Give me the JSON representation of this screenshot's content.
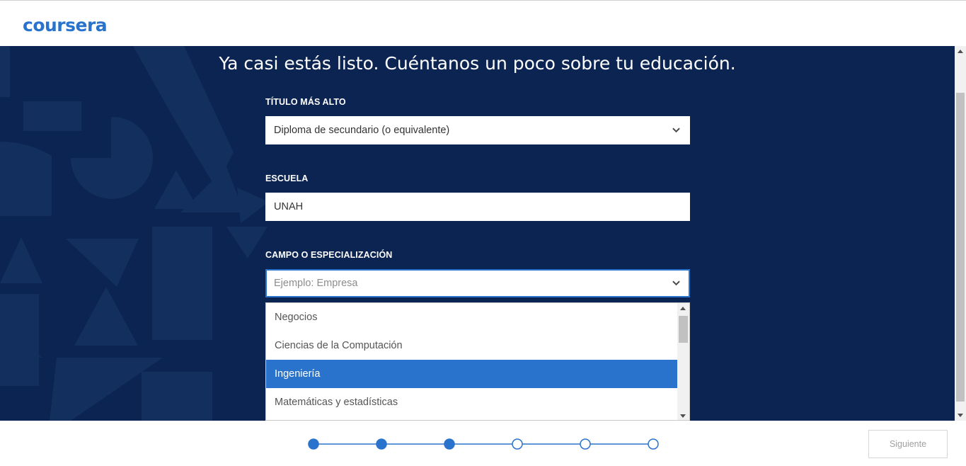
{
  "brand": {
    "logo_text": "coursera",
    "accent": "#2a73cc",
    "hero_bg": "#0b2451"
  },
  "headline": "Ya casi estás listo. Cuéntanos un poco sobre tu educación.",
  "form": {
    "degree": {
      "label": "TÍTULO MÁS ALTO",
      "value": "Diploma de secundario (o equivalente)"
    },
    "school": {
      "label": "ESCUELA",
      "value": "UNAH"
    },
    "field": {
      "label": "CAMPO O ESPECIALIZACIÓN",
      "placeholder": "Ejemplo: Empresa",
      "value": ""
    }
  },
  "dropdown": {
    "options": [
      {
        "label": "Negocios",
        "selected": false
      },
      {
        "label": "Ciencias de la Computación",
        "selected": false
      },
      {
        "label": "Ingeniería",
        "selected": true
      },
      {
        "label": "Matemáticas y estadísticas",
        "selected": false
      }
    ]
  },
  "progress": {
    "total_steps": 6,
    "completed_steps": 3
  },
  "footer": {
    "next_label": "Siguiente"
  },
  "icons": {
    "dropdown_chevron": "chevron-down-icon"
  }
}
